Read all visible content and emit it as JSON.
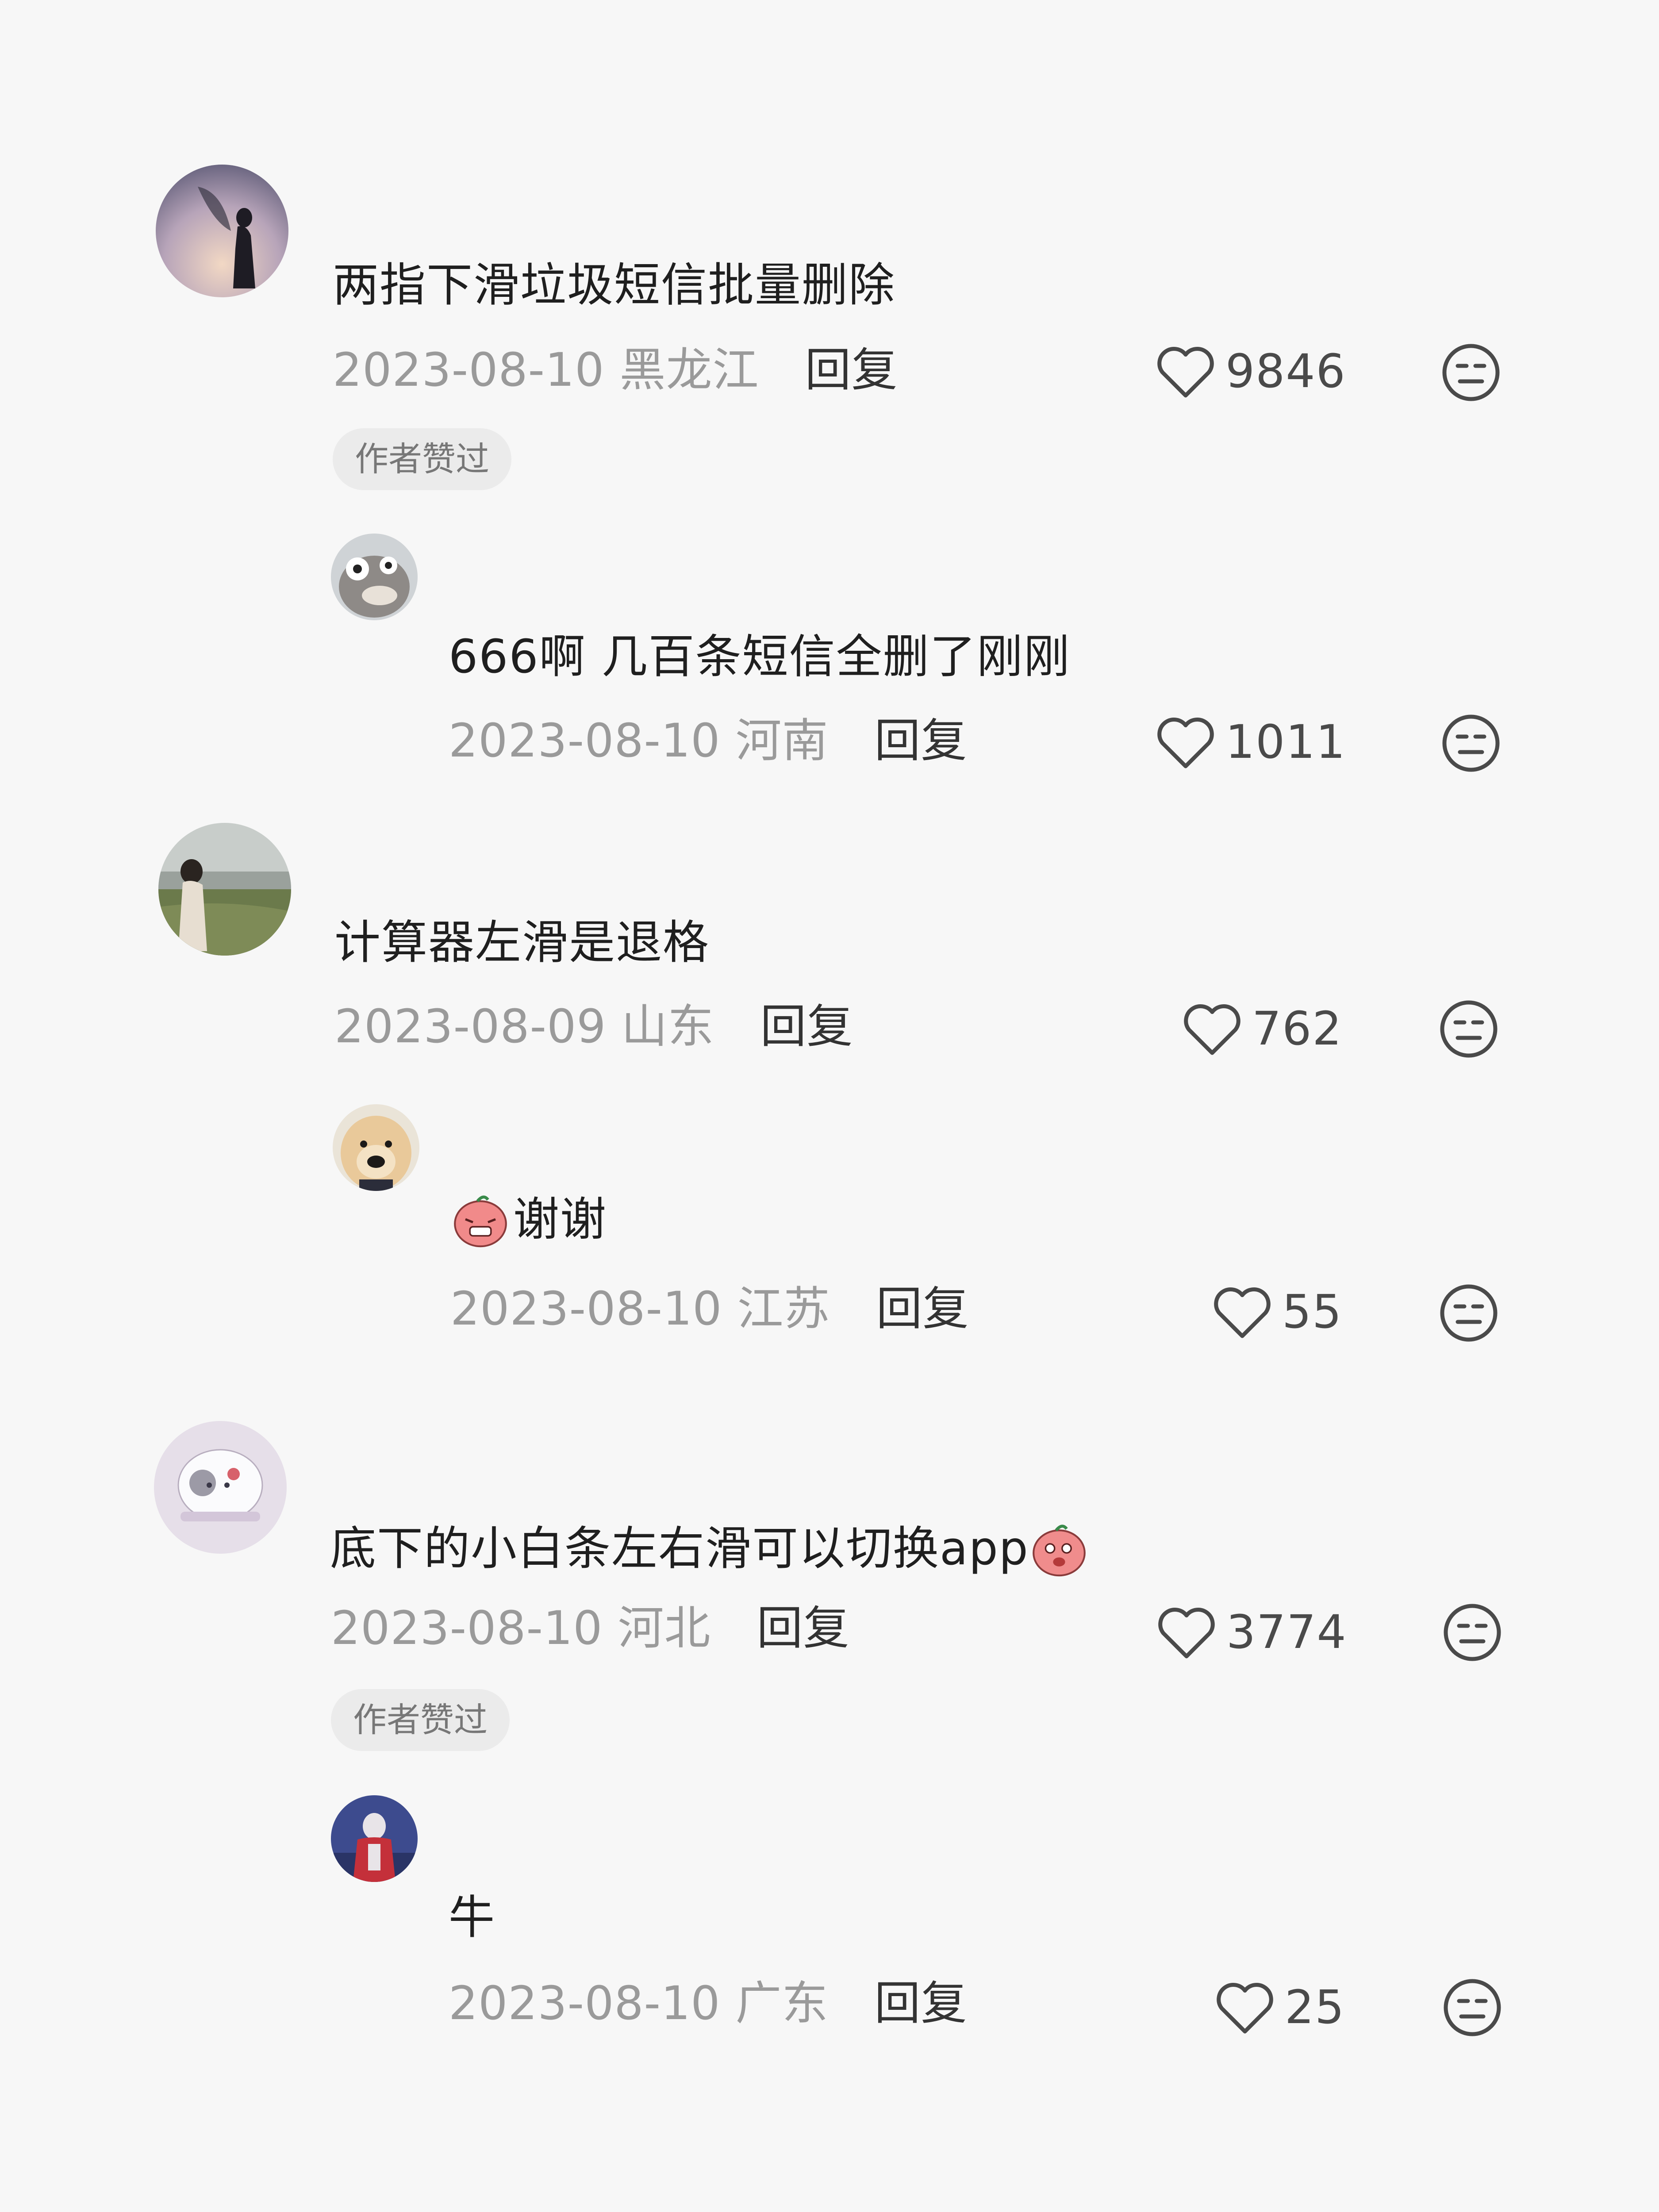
{
  "comments": [
    {
      "text": "两指下滑垃圾短信批量删除",
      "date": "2023-08-10",
      "location": "黑龙江",
      "reply_label": "回复",
      "likes": "9846",
      "badge": "作者赞过",
      "replies": [
        {
          "text": "666啊 几百条短信全删了刚刚",
          "date": "2023-08-10",
          "location": "河南",
          "reply_label": "回复",
          "likes": "1011"
        }
      ]
    },
    {
      "text": "计算器左滑是退格",
      "date": "2023-08-09",
      "location": "山东",
      "reply_label": "回复",
      "likes": "762",
      "replies": [
        {
          "text": "谢谢",
          "emoji": "grimace-bun-emoji",
          "date": "2023-08-10",
          "location": "江苏",
          "reply_label": "回复",
          "likes": "55"
        }
      ]
    },
    {
      "text": "底下的小白条左右滑可以切换app",
      "emoji": "sly-bun-emoji",
      "date": "2023-08-10",
      "location": "河北",
      "reply_label": "回复",
      "likes": "3774",
      "badge": "作者赞过",
      "replies": [
        {
          "text": "牛",
          "date": "2023-08-10",
          "location": "广东",
          "reply_label": "回复",
          "likes": "25"
        }
      ]
    }
  ],
  "icons": {
    "like": "heart-outline-icon",
    "dislike": "neutral-face-icon"
  },
  "colors": {
    "background": "#f7f7f7",
    "text": "#1f1f1f",
    "meta": "#9a9a9a",
    "icon": "#4a4a4a"
  }
}
